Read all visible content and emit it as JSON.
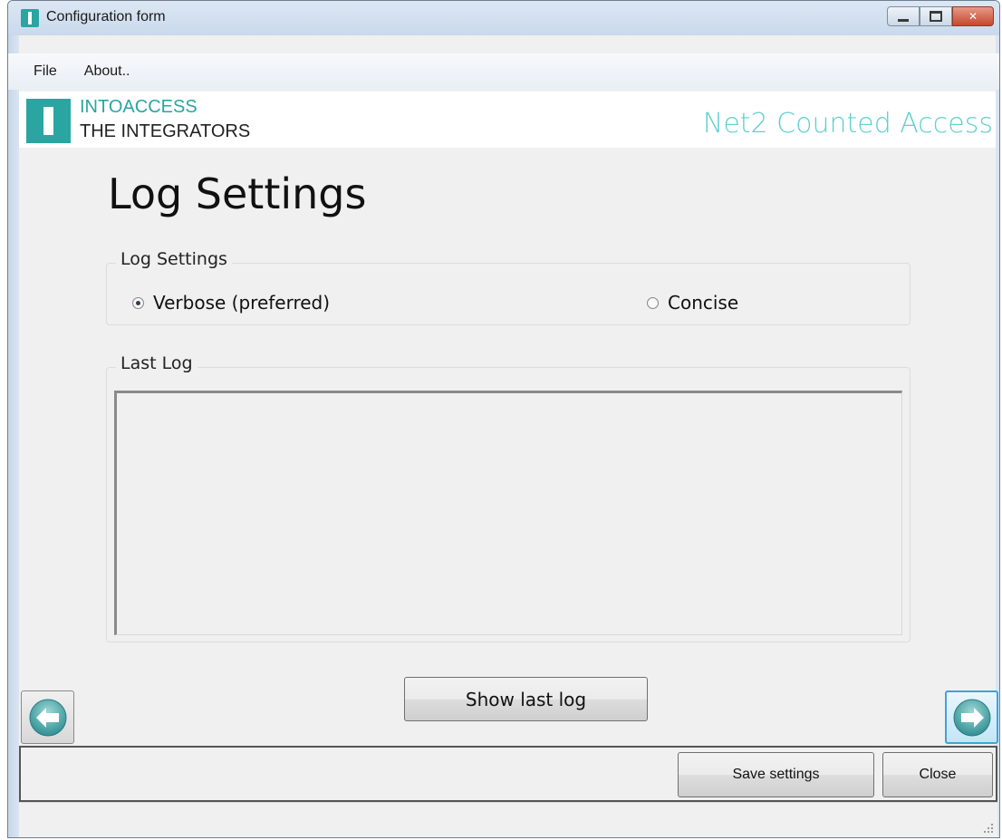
{
  "window": {
    "title": "Configuration form",
    "controls": {
      "minimize": "minimize-icon",
      "maximize": "maximize-icon",
      "close": "close-icon"
    }
  },
  "menu": {
    "items": [
      {
        "label": "File"
      },
      {
        "label": "About.."
      }
    ]
  },
  "banner": {
    "brand_line1": "INTOACCESS",
    "brand_line2": "THE INTEGRATORS",
    "product": "Net2 Counted Access",
    "brand_color": "#2aa5a1",
    "product_color": "#5fcfd0"
  },
  "page": {
    "title": "Log Settings"
  },
  "log_settings": {
    "legend": "Log Settings",
    "options": [
      {
        "label": "Verbose (preferred)",
        "selected": true
      },
      {
        "label": "Concise",
        "selected": false
      }
    ]
  },
  "last_log": {
    "legend": "Last Log",
    "content": ""
  },
  "buttons": {
    "show_last_log": "Show last log",
    "save_settings": "Save settings",
    "close": "Close",
    "prev_icon": "arrow-left-icon",
    "next_icon": "arrow-right-icon"
  }
}
